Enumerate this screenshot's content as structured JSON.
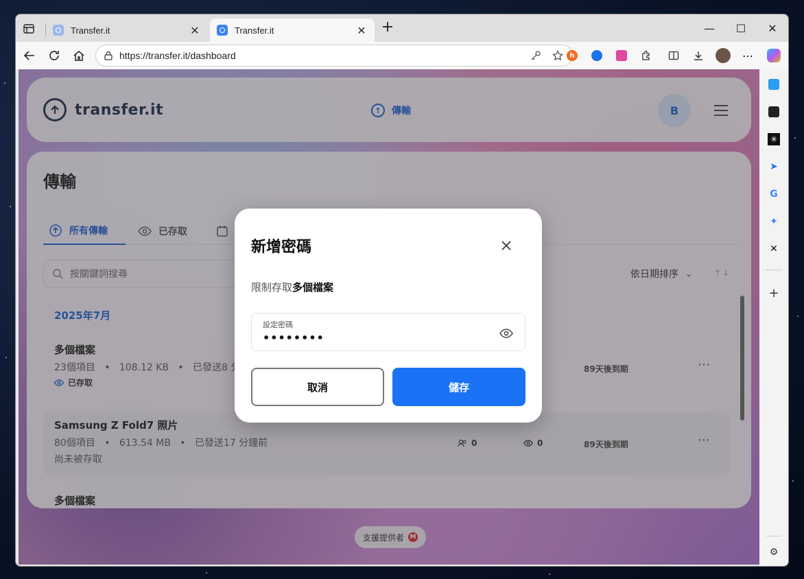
{
  "browser": {
    "tabs": [
      {
        "title": "Transfer.it",
        "active": false
      },
      {
        "title": "Transfer.it",
        "active": true
      }
    ],
    "url": "https://transfer.it/dashboard"
  },
  "header": {
    "logo_text": "transfer.it",
    "nav_transfer": "傳輸",
    "avatar_initial": "B"
  },
  "main": {
    "title": "傳輸",
    "tabs": [
      {
        "label": "所有傳輸",
        "active": true
      },
      {
        "label": "已存取",
        "active": false
      }
    ],
    "search_placeholder": "按關鍵詞搜尋",
    "sort_label": "依日期排序",
    "sort_direction": "↑↓",
    "month": "2025年7月",
    "rows": [
      {
        "name": "多個檔案",
        "items": "23個項目",
        "size": "108.12 KB",
        "sent": "已發送8 分鐘前",
        "status": "已存取",
        "expire": "89天後到期"
      },
      {
        "name": "Samsung Z Fold7 照片",
        "items": "80個項目",
        "size": "613.54 MB",
        "sent": "已發送17 分鐘前",
        "status": "尚未被存取",
        "recipients": "0",
        "views": "0",
        "expire": "89天後到期"
      },
      {
        "name": "多個檔案"
      }
    ],
    "sep": "•",
    "more": "⋯"
  },
  "support": {
    "label": "支援提供者",
    "badge": "M"
  },
  "modal": {
    "title": "新增密碼",
    "subtitle_prefix": "限制存取",
    "subtitle_bold": "多個檔案",
    "field_label": "設定密碼",
    "field_value": "••••••••",
    "cancel": "取消",
    "save": "儲存"
  },
  "colors": {
    "accent": "#1a73f5",
    "link": "#1e5fcf"
  }
}
